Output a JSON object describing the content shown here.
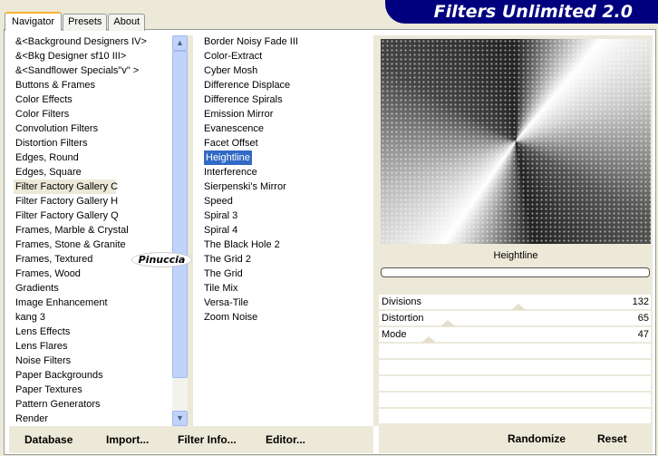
{
  "app_title": "Filters Unlimited 2.0",
  "tabs": [
    "Navigator",
    "Presets",
    "About"
  ],
  "categories": [
    "&<Background Designers IV>",
    "&<Bkg Designer sf10 III>",
    "&<Sandflower Specials\"v\" >",
    "Buttons & Frames",
    "Color Effects",
    "Color Filters",
    "Convolution Filters",
    "Distortion Filters",
    "Edges, Round",
    "Edges, Square",
    "Filter Factory Gallery C",
    "Filter Factory Gallery H",
    "Filter Factory Gallery Q",
    "Frames, Marble & Crystal",
    "Frames, Stone & Granite",
    "Frames, Textured",
    "Frames, Wood",
    "Gradients",
    "Image Enhancement",
    "kang 3",
    "Lens Effects",
    "Lens Flares",
    "Noise Filters",
    "Paper Backgrounds",
    "Paper Textures",
    "Pattern Generators",
    "Render"
  ],
  "selected_category": "Filter Factory Gallery C",
  "filters": [
    "Border Noisy Fade III",
    "Color-Extract",
    "Cyber Mosh",
    "Difference Displace",
    "Difference Spirals",
    "Emission Mirror",
    "Evanescence",
    "Facet Offset",
    "Heightline",
    "Interference",
    "Sierpenski's Mirror",
    "Speed",
    "Spiral 3",
    "Spiral 4",
    "The Black Hole 2",
    "The Grid 2",
    "The Grid",
    "Tile Mix",
    "Versa-Tile",
    "Zoom Noise"
  ],
  "selected_filter": "Heightline",
  "filter_name": "Heightline",
  "progress": 0,
  "params": [
    {
      "label": "Divisions",
      "value": 132,
      "max": 255
    },
    {
      "label": "Distortion",
      "value": 65,
      "max": 255
    },
    {
      "label": "Mode",
      "value": 47,
      "max": 255
    }
  ],
  "buttons": {
    "database": "Database",
    "import": "Import...",
    "filter_info": "Filter Info...",
    "editor": "Editor...",
    "randomize": "Randomize",
    "reset": "Reset"
  },
  "watermark": "Pinuccia"
}
